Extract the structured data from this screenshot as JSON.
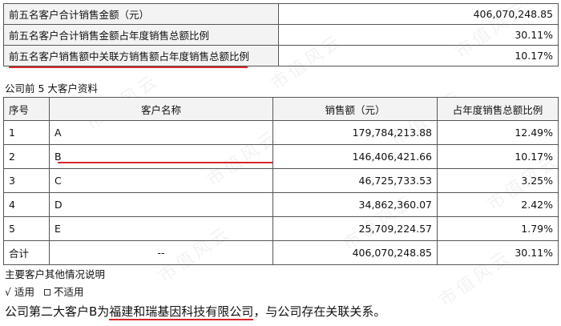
{
  "summary": [
    {
      "label": "前五名客户合计销售金额（元）",
      "value": "406,070,248.85"
    },
    {
      "label": "前五名客户合计销售金额占年度销售总额比例",
      "value": "30.11%"
    },
    {
      "label": "前五名客户销售额中关联方销售额占年度销售总额比例",
      "value": "10.17%"
    }
  ],
  "section_title": "公司前 5 大客户资料",
  "table": {
    "headers": {
      "no": "序号",
      "name": "客户名称",
      "sales": "销售额（元）",
      "ratio": "占年度销售总额比例"
    },
    "rows": [
      {
        "no": "1",
        "name": "A",
        "sales": "179,784,213.88",
        "ratio": "12.49%"
      },
      {
        "no": "2",
        "name": "B",
        "sales": "146,406,421.66",
        "ratio": "10.17%"
      },
      {
        "no": "3",
        "name": "C",
        "sales": "46,725,733.53",
        "ratio": "3.25%"
      },
      {
        "no": "4",
        "name": "D",
        "sales": "34,862,360.07",
        "ratio": "2.42%"
      },
      {
        "no": "5",
        "name": "E",
        "sales": "25,709,224.57",
        "ratio": "1.79%"
      }
    ],
    "total": {
      "label": "合计",
      "name": "--",
      "sales": "406,070,248.85",
      "ratio": "30.11%"
    }
  },
  "other_notes_title": "主要客户其他情况说明",
  "applicability": {
    "check": "√",
    "applicable": "适用",
    "not_applicable": "不适用"
  },
  "note": {
    "prefix": "公司第二大客户B为",
    "company": "福建和瑞基因科技有限公司",
    "suffix": "，与公司存在关联关系。"
  },
  "watermark": "市值风云",
  "colors": {
    "underline": "#d9252b",
    "header_bg": "#f3f3f3"
  }
}
